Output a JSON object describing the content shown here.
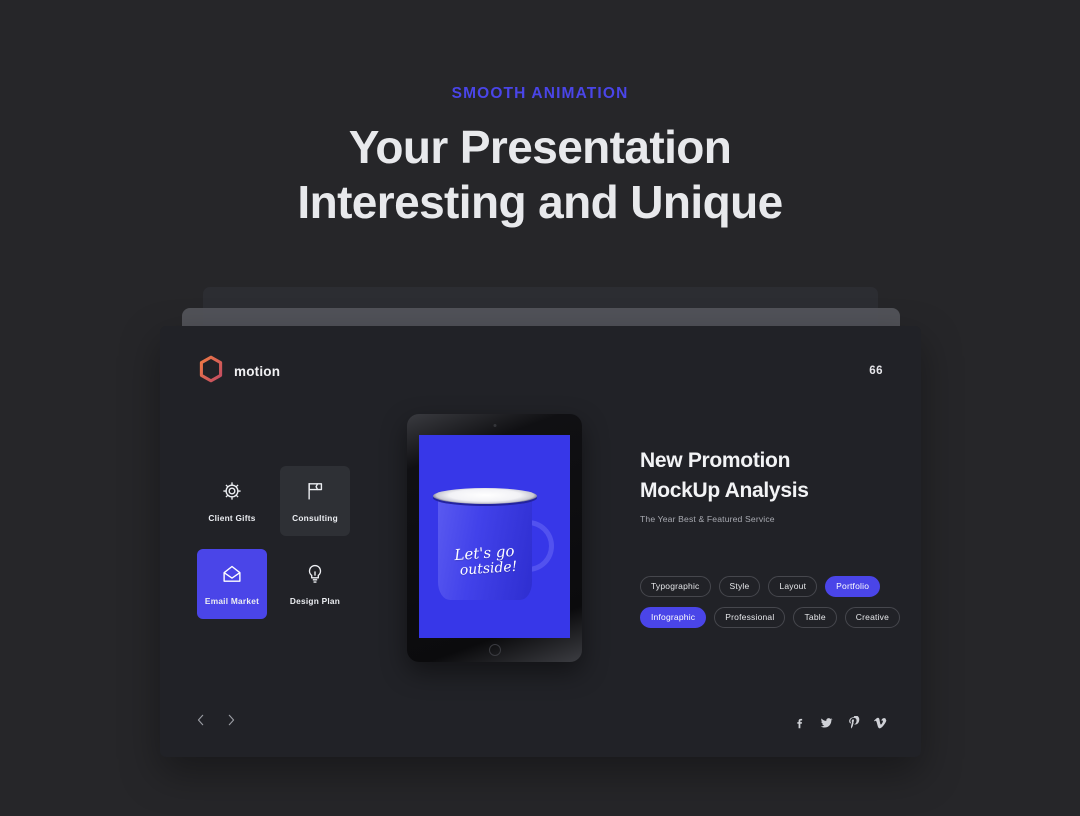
{
  "hero": {
    "eyebrow": "SMOOTH ANIMATION",
    "headline_line1": "Your Presentation",
    "headline_line2": "Interesting and Unique",
    "accent_color": "#4a45e8",
    "background_color": "#262629"
  },
  "slide": {
    "background_color": "#212227",
    "brand": {
      "logo_icon": "hexagon-outline-icon",
      "logo_gradient": [
        "#e8613c",
        "#c9475a"
      ],
      "name": "motion"
    },
    "page_number": "66",
    "tiles": [
      {
        "label": "Client Gifts",
        "icon": "gear-icon",
        "state": "default"
      },
      {
        "label": "Consulting",
        "icon": "flag-icon",
        "state": "hover"
      },
      {
        "label": "Email Market",
        "icon": "envelope-icon",
        "state": "active"
      },
      {
        "label": "Design Plan",
        "icon": "lightbulb-icon",
        "state": "default"
      }
    ],
    "device": {
      "type": "tablet-mockup",
      "screen_color": "#3737e8",
      "artwork": "blue enamel mug",
      "artwork_text_line1": "Let's go",
      "artwork_text_line2": "outside!"
    },
    "copy": {
      "title_line1": "New Promotion",
      "title_line2": "MockUp Analysis",
      "subtitle": "The Year Best & Featured Service"
    },
    "tags_row1": [
      {
        "label": "Typographic",
        "selected": false
      },
      {
        "label": "Style",
        "selected": false
      },
      {
        "label": "Layout",
        "selected": false
      },
      {
        "label": "Portfolio",
        "selected": true
      }
    ],
    "tags_row2": [
      {
        "label": "Infographic",
        "selected": true
      },
      {
        "label": "Professional",
        "selected": false
      },
      {
        "label": "Table",
        "selected": false
      },
      {
        "label": "Creative",
        "selected": false
      }
    ],
    "nav": {
      "prev_icon": "chevron-left-icon",
      "next_icon": "chevron-right-icon"
    },
    "socials": [
      {
        "name": "facebook-icon",
        "glyph": "f"
      },
      {
        "name": "twitter-icon",
        "glyph": "t"
      },
      {
        "name": "pinterest-icon",
        "glyph": "p"
      },
      {
        "name": "vimeo-icon",
        "glyph": "v"
      }
    ]
  }
}
